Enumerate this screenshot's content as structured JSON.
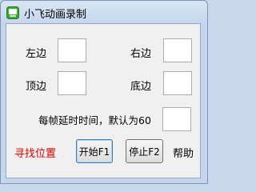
{
  "window": {
    "title": "小飞动画录制",
    "icon": "green-app-icon"
  },
  "fields": {
    "left_label": "左边",
    "left_value": "",
    "right_label": "右边",
    "right_value": "",
    "top_label": "顶边",
    "top_value": "",
    "bottom_label": "底边",
    "bottom_value": "",
    "delay_label": "每帧延时时间，默认为60",
    "delay_value": ""
  },
  "actions": {
    "find_position": "寻找位置",
    "start": "开始F1",
    "stop": "停止F2",
    "help": "帮助"
  },
  "colors": {
    "find_link": "#e00000",
    "titlebar": "#c4d6ec",
    "client": "#f0f0f0"
  }
}
